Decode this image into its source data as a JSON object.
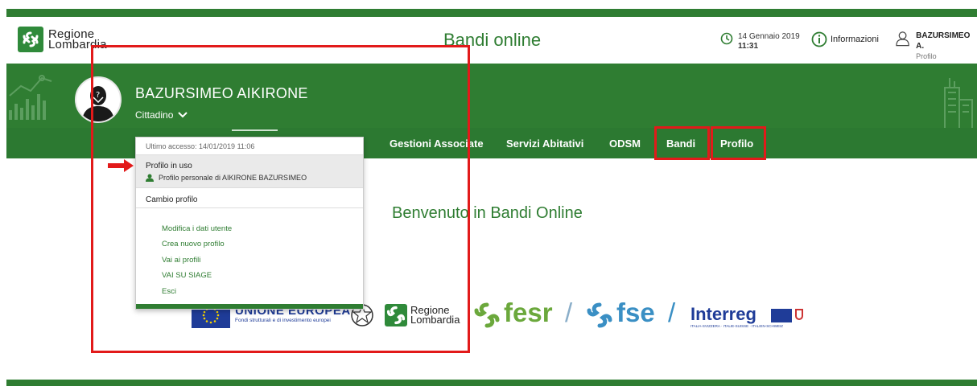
{
  "header": {
    "logo_line1": "Regione",
    "logo_line2": "Lombardia",
    "site_title": "Bandi online",
    "date": "14 Gennaio 2019",
    "time": "11:31",
    "info_label": "Informazioni",
    "user_short": "BAZURSIMEO A.",
    "user_sub": "Profilo"
  },
  "profile": {
    "name": "BAZURSIMEO AIKIRONE",
    "role": "Cittadino"
  },
  "nav": {
    "items": [
      "Gestioni Associate",
      "Servizi Abitativi",
      "ODSM",
      "Bandi",
      "Profilo"
    ]
  },
  "dropdown": {
    "last_access": "Ultimo accesso: 14/01/2019 11:06",
    "profile_in_use_title": "Profilo in uso",
    "profile_in_use": "Profilo personale di AIKIRONE BAZURSIMEO",
    "change_profile": "Cambio profilo",
    "links": [
      "Modifica i dati utente",
      "Crea nuovo profilo",
      "Vai ai profili",
      "VAI SU SIAGE",
      "Esci"
    ]
  },
  "main": {
    "welcome": "Benvenuto in Bandi Online"
  },
  "footer": {
    "eu_title": "UNIONE EUROPEA",
    "eu_sub": "Fondi strutturali e di investimento europei",
    "rl_line1": "Regione",
    "rl_line2": "Lombardia",
    "fesr": "fesr",
    "slash": "/",
    "fse": "fse",
    "interreg": "Interreg",
    "interreg_sub": "ITALIA-SVIZZERA · ITALIE-SUISSE · ITALIEN-SCHWEIZ"
  },
  "colors": {
    "brand_green": "#2f7d32",
    "highlight_red": "#e21a1a"
  }
}
